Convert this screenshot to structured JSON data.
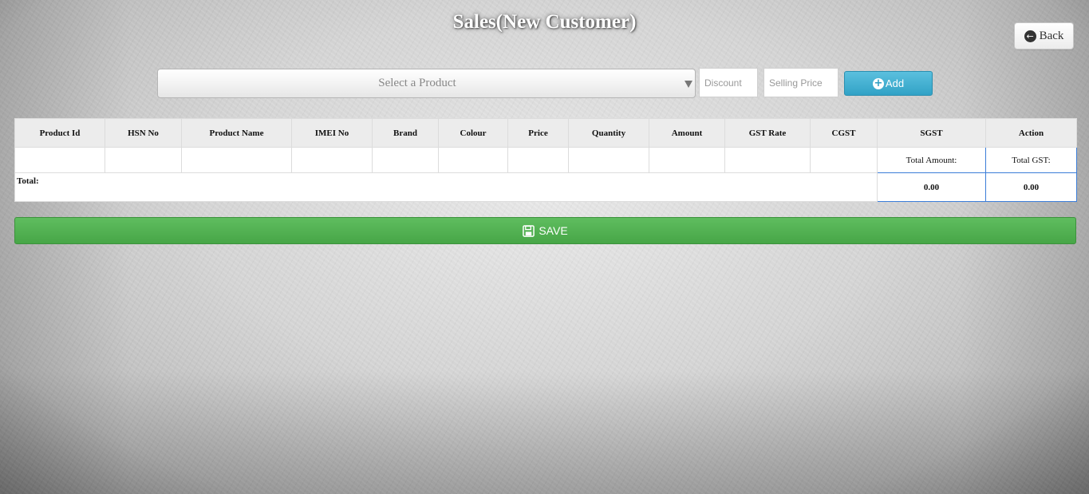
{
  "page": {
    "title": "Sales(New Customer)"
  },
  "header": {
    "back_label": "Back",
    "back_icon": "circle-arrow-left-icon"
  },
  "form": {
    "product_placeholder": "Select a Product",
    "discount_placeholder": "Discount",
    "selling_price_placeholder": "Selling Price",
    "add_label": "Add",
    "add_icon": "plus-circle-icon"
  },
  "table": {
    "columns": [
      "Product Id",
      "HSN No",
      "Product Name",
      "IMEI No",
      "Brand",
      "Colour",
      "Price",
      "Quantity",
      "Amount",
      "GST Rate",
      "CGST",
      "SGST",
      "Action"
    ],
    "total_amount_label": "Total Amount:",
    "total_gst_label": "Total GST:",
    "total_label": "Total:",
    "total_amount_value": "0.00",
    "total_gst_value": "0.00"
  },
  "actions": {
    "save_label": "SAVE",
    "save_icon": "floppy-disk-icon"
  },
  "colors": {
    "add_button": "#31a2c6",
    "save_button": "#4cae4c",
    "total_cell_border": "#3b7dd8",
    "header_background": "#ececec"
  }
}
